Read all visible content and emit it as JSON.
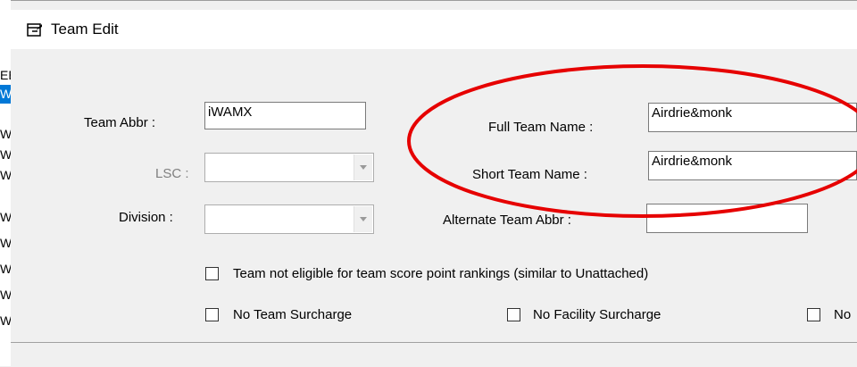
{
  "background_rows": [
    "EB",
    "WA",
    "WA",
    "WE",
    "WE",
    "WC",
    "WC",
    "WD",
    "WD",
    "WE"
  ],
  "dialog": {
    "title": "Team Edit",
    "title_icon": "edit-window-icon"
  },
  "form": {
    "team_abbr_label": "Team Abbr :",
    "team_abbr_value": "iWAMX",
    "lsc_label": "LSC :",
    "division_label": "Division :",
    "full_name_label": "Full Team Name :",
    "full_name_value": "Airdrie&monk",
    "short_name_label": "Short Team Name :",
    "short_name_value": "Airdrie&monk",
    "alt_abbr_label": "Alternate Team Abbr :",
    "alt_abbr_value": ""
  },
  "checkboxes": {
    "not_eligible": "Team not eligible for team score point rankings (similar to Unattached)",
    "no_team_surcharge": "No Team Surcharge",
    "no_facility_surcharge": "No Facility Surcharge",
    "no_third": "No"
  },
  "annotation_color": "#e60000"
}
